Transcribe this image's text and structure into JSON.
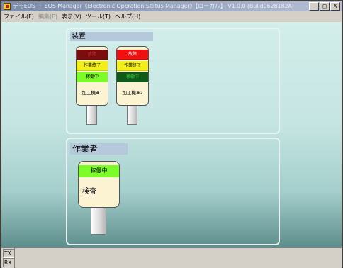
{
  "window": {
    "title": "デモEOS － EOS Manager《Electronic Operation Status Manager》【ローカル】 V1.0.0 (Build0628182A)",
    "controls": {
      "minimize": "_",
      "maximize": "□",
      "close": "X"
    }
  },
  "menu": [
    {
      "label": "ファイル(F)",
      "enabled": true
    },
    {
      "label": "編集(E)",
      "enabled": false
    },
    {
      "label": "表示(V)",
      "enabled": true
    },
    {
      "label": "ツール(T)",
      "enabled": true
    },
    {
      "label": "ヘルプ(H)",
      "enabled": true
    }
  ],
  "devices_panel": {
    "title": "装置",
    "machines": [
      {
        "name": "加工機#1",
        "lamps": [
          {
            "label": "故障",
            "color": "#7a0e0e",
            "text_color": "#d03030"
          },
          {
            "label": "作業終了",
            "color": "#f2ee18",
            "text_color": "#000000"
          },
          {
            "label": "稼働中",
            "color": "#7cfc28",
            "text_color": "#000000"
          }
        ]
      },
      {
        "name": "加工機#2",
        "lamps": [
          {
            "label": "故障",
            "color": "#f01010",
            "text_color": "#ffffff"
          },
          {
            "label": "作業終了",
            "color": "#f2ee18",
            "text_color": "#000000"
          },
          {
            "label": "稼働中",
            "color": "#0f5a18",
            "text_color": "#38c838"
          }
        ]
      }
    ]
  },
  "workers_panel": {
    "title": "作業者",
    "workers": [
      {
        "name": "検査",
        "lamps": [
          {
            "label": "稼働中",
            "color": "#7cfc28",
            "text_color": "#000000"
          }
        ]
      }
    ]
  },
  "status": {
    "tx": "TX",
    "rx": "RX"
  },
  "colors": {
    "background_top": "#d3eeeb",
    "background_bottom": "#5d8e8c",
    "panel_title_bg": "#b6c9dc"
  }
}
